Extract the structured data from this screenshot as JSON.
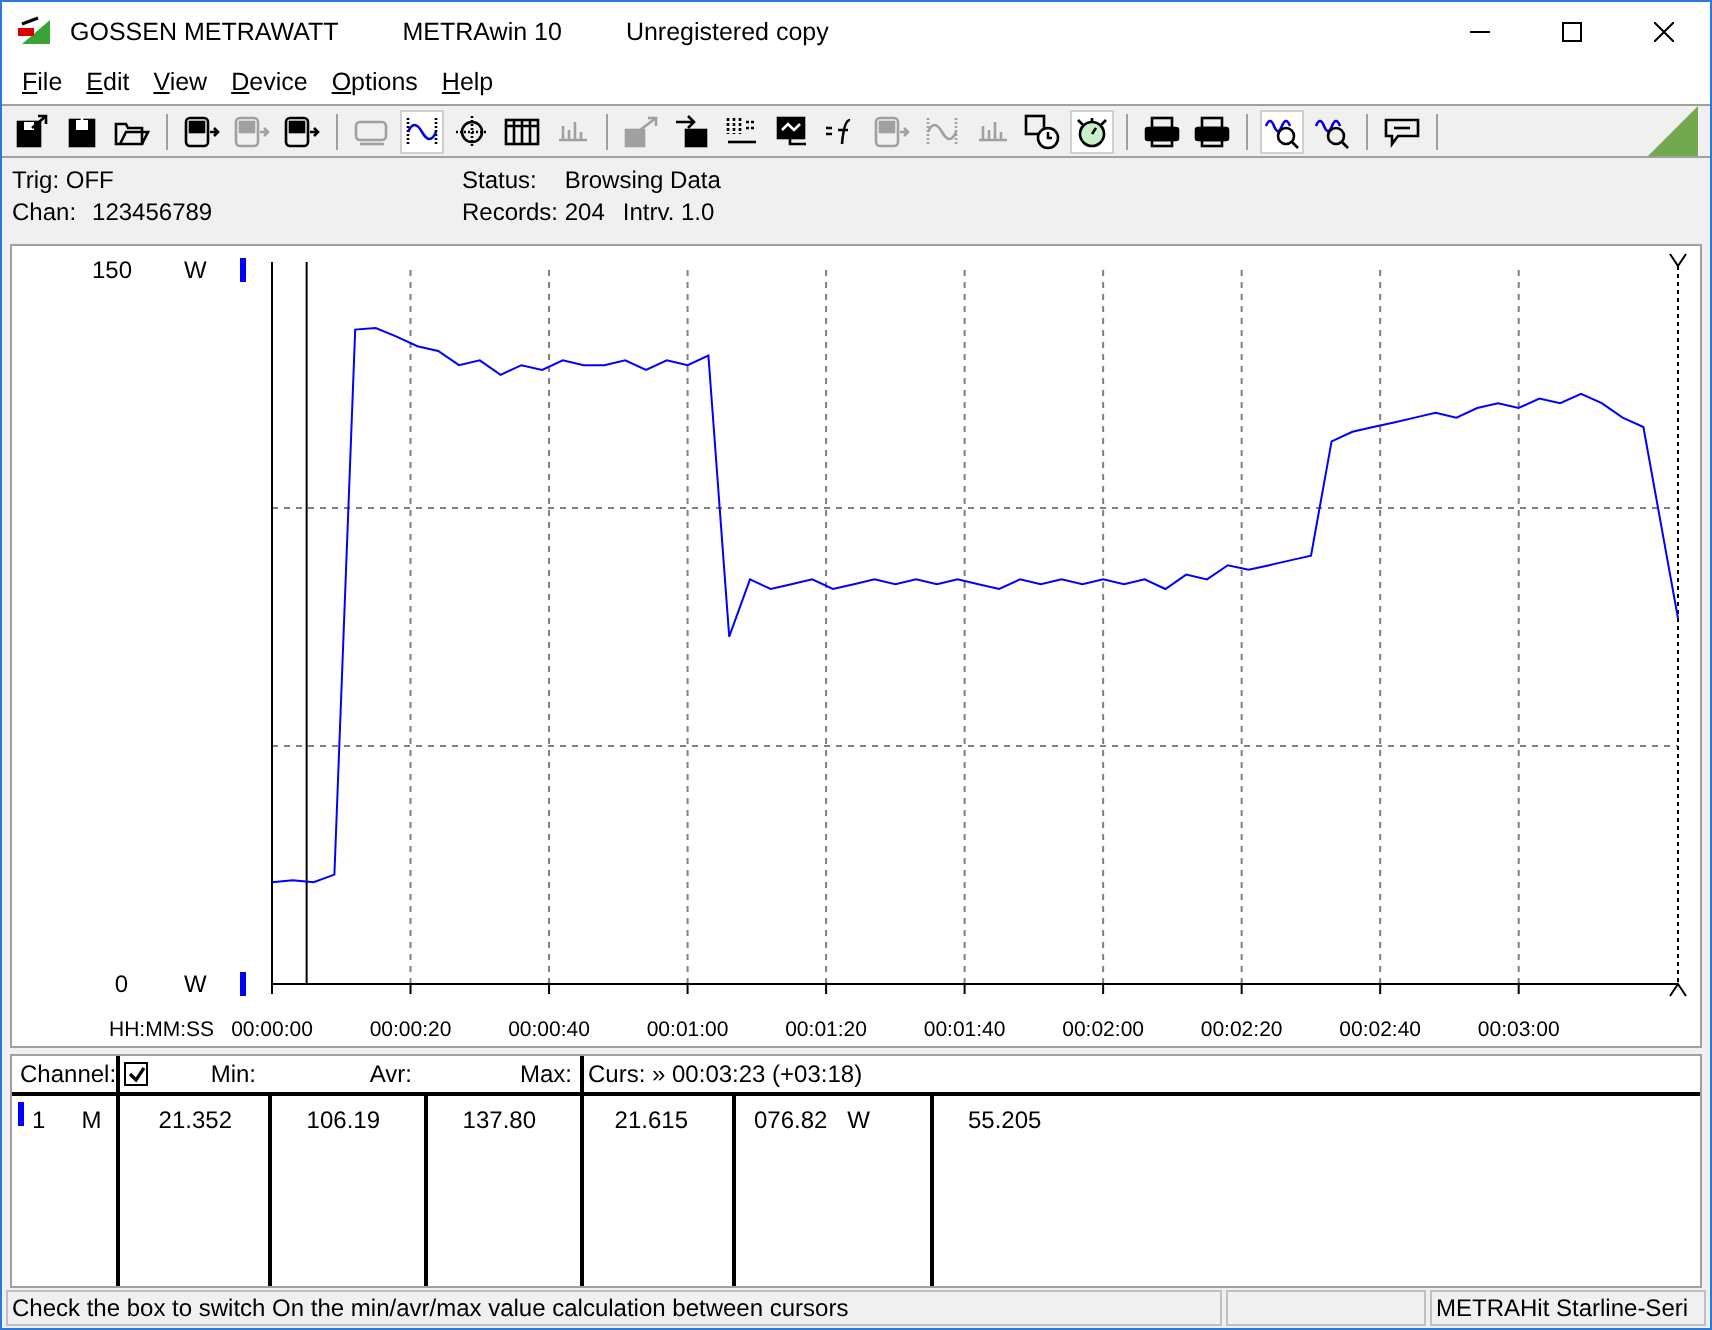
{
  "window": {
    "title_parts": [
      "GOSSEN METRAWATT",
      "METRAwin 10",
      "Unregistered copy"
    ]
  },
  "menu": [
    "File",
    "Edit",
    "View",
    "Device",
    "Options",
    "Help"
  ],
  "toolbar": [
    {
      "kind": "save-arrow",
      "selected": false,
      "disabled": false
    },
    {
      "kind": "save",
      "selected": false,
      "disabled": false
    },
    {
      "kind": "folder",
      "selected": false,
      "disabled": false
    },
    {
      "kind": "separator"
    },
    {
      "kind": "device",
      "selected": false,
      "disabled": false
    },
    {
      "kind": "device",
      "selected": false,
      "disabled": true
    },
    {
      "kind": "device",
      "selected": false,
      "disabled": false
    },
    {
      "kind": "separator"
    },
    {
      "kind": "display",
      "selected": false,
      "disabled": true
    },
    {
      "kind": "wave",
      "selected": true,
      "disabled": false
    },
    {
      "kind": "crosshair",
      "selected": false,
      "disabled": false
    },
    {
      "kind": "table",
      "selected": false,
      "disabled": false
    },
    {
      "kind": "bars",
      "selected": false,
      "disabled": true
    },
    {
      "kind": "separator"
    },
    {
      "kind": "export",
      "selected": false,
      "disabled": true
    },
    {
      "kind": "import",
      "selected": false,
      "disabled": false
    },
    {
      "kind": "bits",
      "selected": false,
      "disabled": false
    },
    {
      "kind": "monitor",
      "selected": false,
      "disabled": false
    },
    {
      "kind": "function",
      "selected": false,
      "disabled": false
    },
    {
      "kind": "device",
      "selected": false,
      "disabled": true
    },
    {
      "kind": "wave",
      "selected": false,
      "disabled": true
    },
    {
      "kind": "bars",
      "selected": false,
      "disabled": true
    },
    {
      "kind": "clock",
      "selected": false,
      "disabled": false
    },
    {
      "kind": "stopwatch",
      "selected": true,
      "disabled": false
    },
    {
      "kind": "separator"
    },
    {
      "kind": "printer",
      "selected": false,
      "disabled": false
    },
    {
      "kind": "printer",
      "selected": false,
      "disabled": false
    },
    {
      "kind": "separator"
    },
    {
      "kind": "zoom",
      "selected": true,
      "disabled": false
    },
    {
      "kind": "zoom",
      "selected": false,
      "disabled": false
    },
    {
      "kind": "separator"
    },
    {
      "kind": "comment",
      "selected": false,
      "disabled": false
    },
    {
      "kind": "separator"
    }
  ],
  "info": {
    "trig": "Trig: OFF",
    "chan_label": "Chan:",
    "chan_value": "123456789",
    "status_label": "Status:",
    "status_value": "Browsing Data",
    "records": "Records: 204",
    "interval": "Intrv. 1.0"
  },
  "chart": {
    "unit_top": "W",
    "unit_bottom": "W",
    "chart_data": {
      "type": "line",
      "xlabel": "HH:MM:SS",
      "ylim": [
        0,
        150
      ],
      "xlim": [
        0,
        203
      ],
      "yticks": [
        {
          "value": 0,
          "label": "0"
        },
        {
          "value": 150,
          "label": "150"
        }
      ],
      "ref_lines": [
        {
          "axis": "x",
          "value": 5
        },
        {
          "axis": "x",
          "value": 203
        }
      ],
      "grid": true,
      "xticks": [
        {
          "value": 0,
          "label": "00:00:00"
        },
        {
          "value": 20,
          "label": "00:00:20"
        },
        {
          "value": 40,
          "label": "00:00:40"
        },
        {
          "value": 60,
          "label": "00:01:00"
        },
        {
          "value": 80,
          "label": "00:01:20"
        },
        {
          "value": 100,
          "label": "00:01:40"
        },
        {
          "value": 120,
          "label": "00:02:00"
        },
        {
          "value": 140,
          "label": "00:02:20"
        },
        {
          "value": 160,
          "label": "00:02:40"
        },
        {
          "value": 180,
          "label": "00:03:00"
        }
      ],
      "x": [
        0,
        3,
        6,
        9,
        12,
        15,
        18,
        21,
        24,
        27,
        30,
        33,
        36,
        39,
        42,
        45,
        48,
        51,
        54,
        57,
        60,
        63,
        66,
        69,
        72,
        75,
        78,
        81,
        84,
        87,
        90,
        93,
        96,
        99,
        102,
        105,
        108,
        111,
        114,
        117,
        120,
        123,
        126,
        129,
        132,
        135,
        138,
        141,
        144,
        147,
        150,
        153,
        156,
        159,
        162,
        165,
        168,
        171,
        174,
        177,
        180,
        183,
        186,
        189,
        192,
        195,
        198,
        203
      ],
      "series": [
        {
          "color": "#0000ff",
          "values": [
            21.4,
            21.8,
            21.4,
            23,
            137.5,
            137.8,
            136,
            134,
            133,
            130,
            131,
            128,
            130,
            129,
            131,
            130,
            130,
            131,
            129,
            131,
            130,
            132,
            73,
            85,
            83,
            84,
            85,
            83,
            84,
            85,
            84,
            85,
            84,
            85,
            84,
            83,
            85,
            84,
            85,
            84,
            85,
            84,
            85,
            83,
            86,
            85,
            88,
            87,
            88,
            89,
            90,
            114,
            116,
            117,
            118,
            119,
            120,
            119,
            121,
            122,
            121,
            123,
            122,
            124,
            122,
            119,
            117,
            76.8
          ]
        }
      ]
    }
  },
  "table": {
    "headers": {
      "channel": "Channel:",
      "checked": true,
      "min": "Min:",
      "avr": "Avr:",
      "max": "Max:",
      "cursor": "Curs: » 00:03:23 (+03:18)"
    },
    "rows": [
      {
        "color": "#0000ff",
        "channel": "1",
        "mode": "M",
        "min": "21.352",
        "avr": "106.19",
        "max": "137.80",
        "cursor_1": "21.615",
        "cursor_2": "076.82",
        "unit": "W",
        "cursor_3": "55.205"
      }
    ]
  },
  "status_bar": {
    "message": "Check the box to switch On the min/avr/max value calculation between cursors",
    "device": "METRAHit Starline-Seri"
  }
}
